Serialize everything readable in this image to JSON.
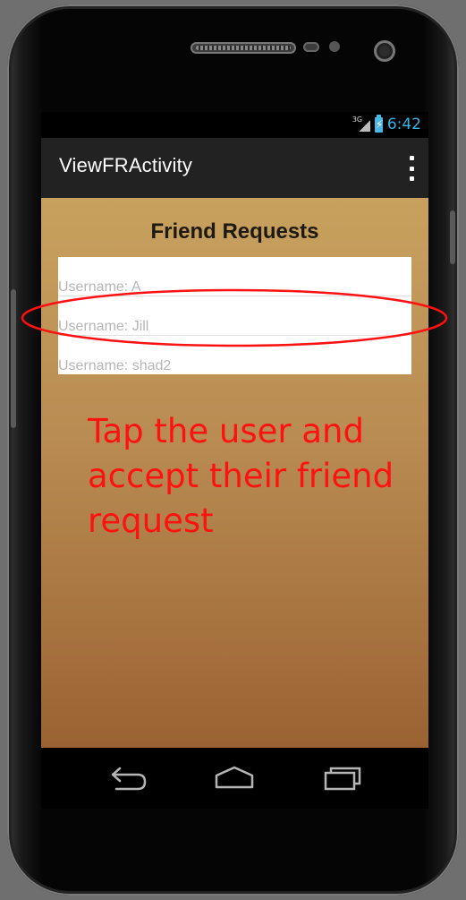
{
  "status_bar": {
    "network_label": "3G",
    "time": "6:42"
  },
  "action_bar": {
    "title": "ViewFRActivity"
  },
  "content": {
    "heading": "Friend Requests",
    "list": [
      {
        "label": "Username: A"
      },
      {
        "label": "Username: Jill"
      },
      {
        "label": "Username: shad2"
      }
    ]
  },
  "overlay": {
    "instruction": "Tap the user and accept their friend request",
    "highlighted_item": "Username: Jill",
    "annotation_color": "#ff1111"
  },
  "colors": {
    "clock": "#33b5e5",
    "action_bar": "#222222",
    "content_top": "#c8a15e",
    "content_bottom": "#9a6232"
  },
  "icons": [
    "back-icon",
    "home-icon",
    "recent-apps-icon",
    "overflow-menu-icon",
    "battery-icon",
    "signal-icon"
  ]
}
